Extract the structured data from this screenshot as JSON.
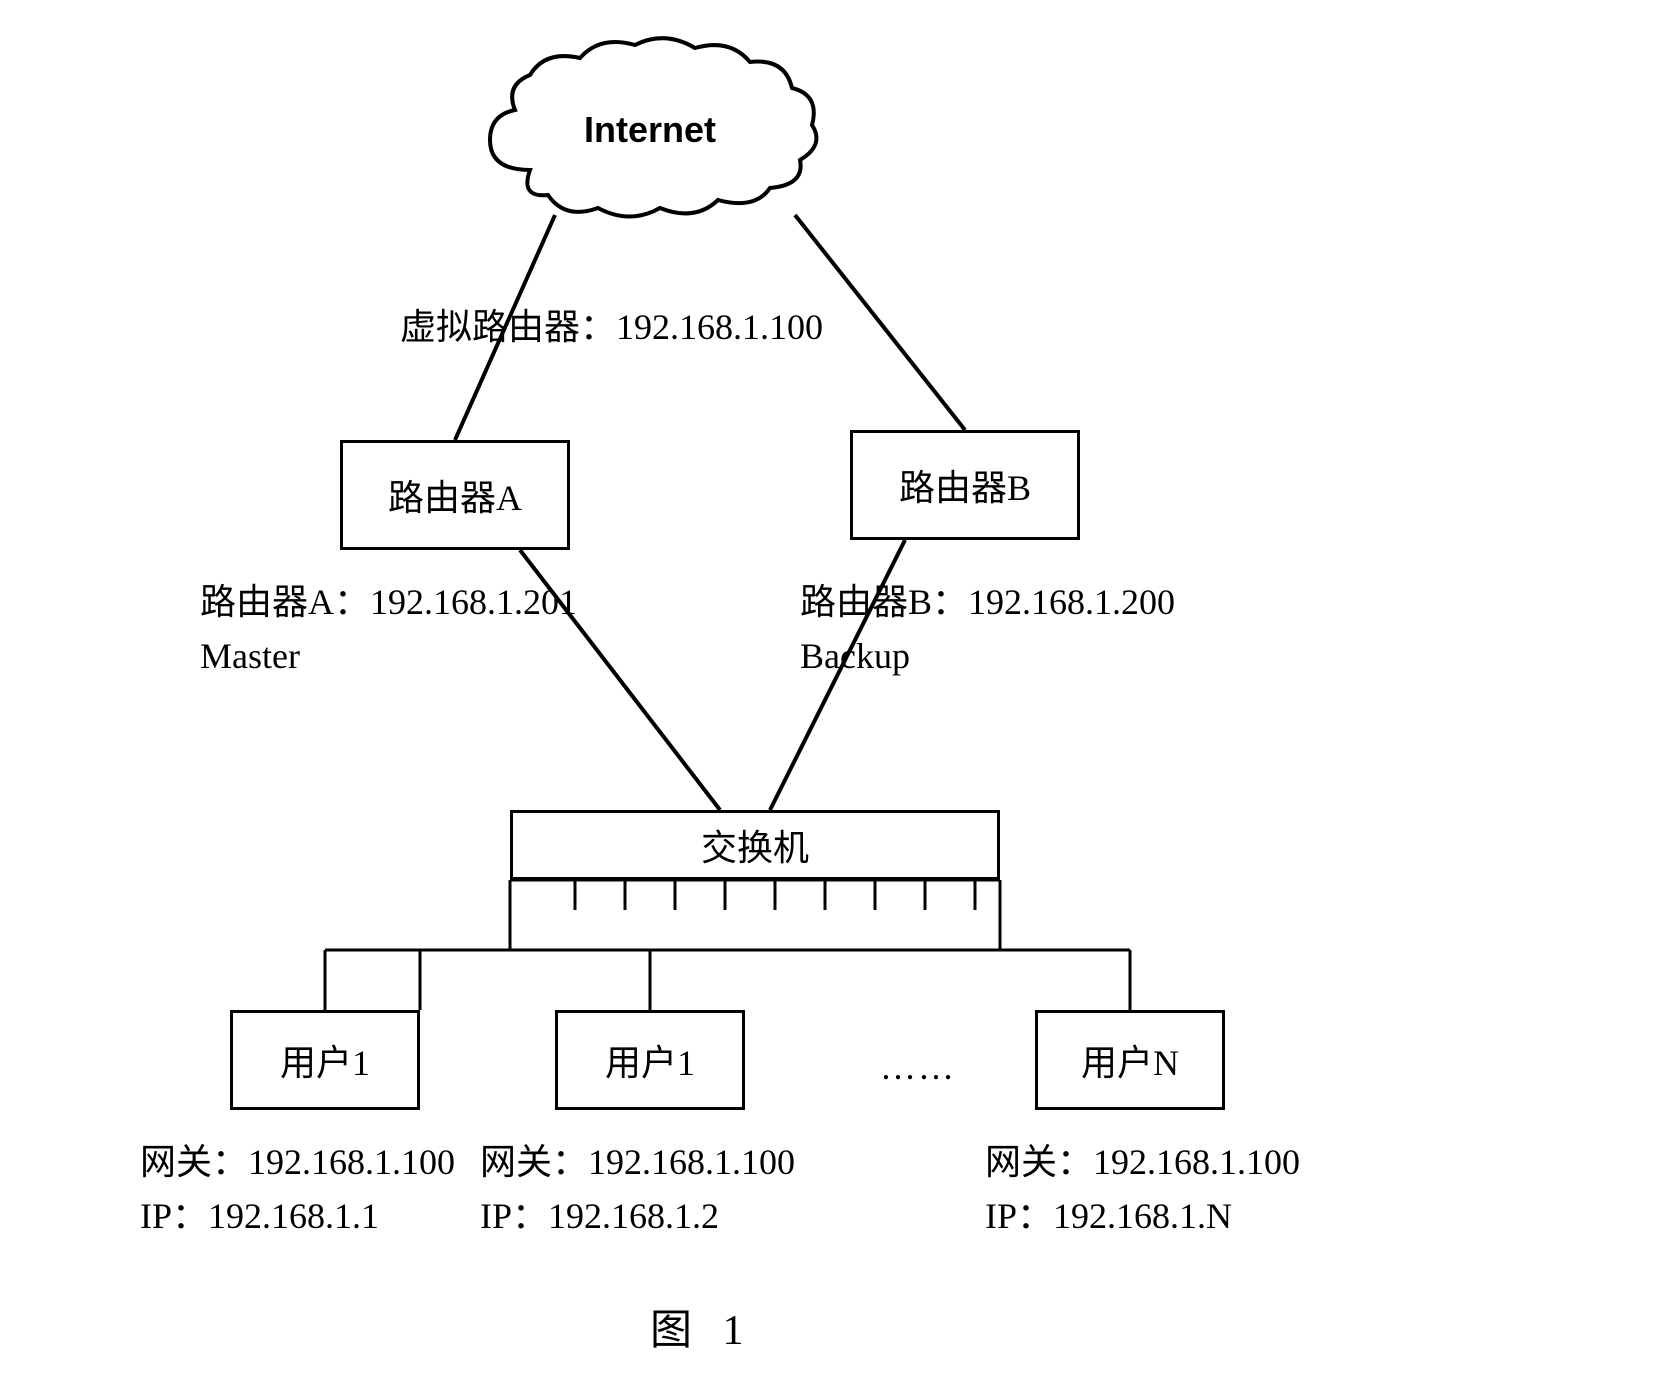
{
  "cloud": {
    "label": "Internet"
  },
  "virtual_router": {
    "text": "虚拟路由器：192.168.1.100"
  },
  "router_a": {
    "box": "路由器A",
    "label": "路由器A：192.168.1.201\nMaster"
  },
  "router_b": {
    "box": "路由器B",
    "label": "路由器B：192.168.1.200\nBackup"
  },
  "switch": {
    "label": "交换机"
  },
  "users": {
    "u1": {
      "box": "用户1",
      "label": "网关：192.168.1.100\nIP：192.168.1.1"
    },
    "u2": {
      "box": "用户1",
      "label": "网关：192.168.1.100\nIP：192.168.1.2"
    },
    "dots": "……",
    "uN": {
      "box": "用户N",
      "label": "网关：192.168.1.100\nIP：192.168.1.N"
    }
  },
  "figure": {
    "label": "图 1"
  }
}
